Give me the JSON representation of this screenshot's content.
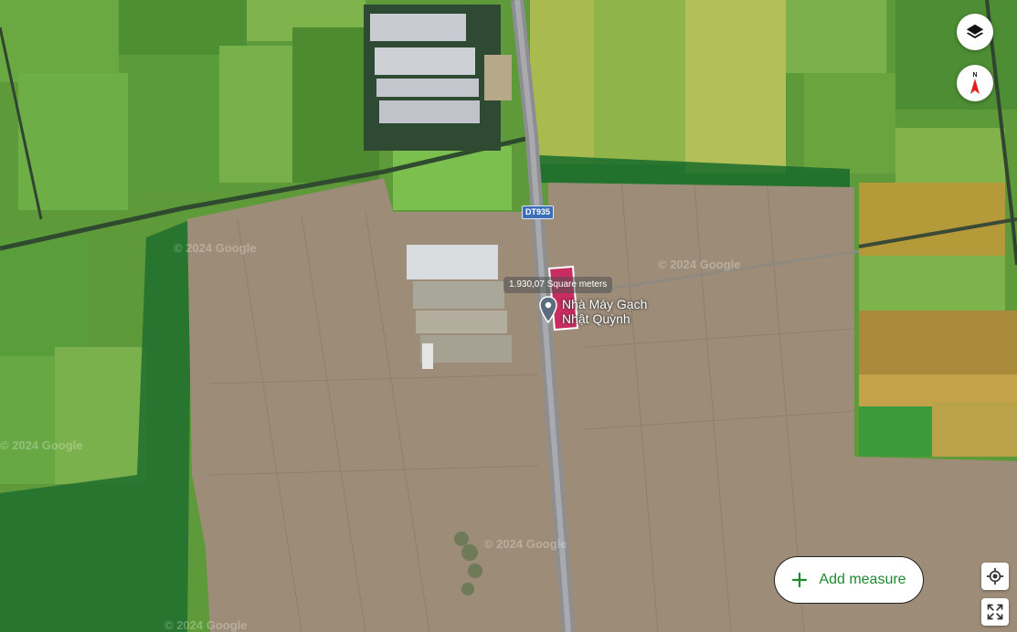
{
  "map": {
    "road_label": "DT935",
    "place_name_line1": "Nhà Máy Gạch",
    "place_name_line2": "Nhật Quỳnh",
    "measurement_label": "1.930,07 Square meters",
    "watermark": "© 2024 Google"
  },
  "controls": {
    "layers_icon": "layers-icon",
    "compass_icon": "compass-icon",
    "compass_letter": "N",
    "add_measure_label": "Add measure",
    "add_icon": "plus-icon",
    "locate_icon": "my-location-icon",
    "fullscreen_icon": "fullscreen-icon"
  },
  "colors": {
    "measure_fill": "#d4145a",
    "accent_green": "#1e8a2e",
    "compass_red": "#e02020"
  }
}
